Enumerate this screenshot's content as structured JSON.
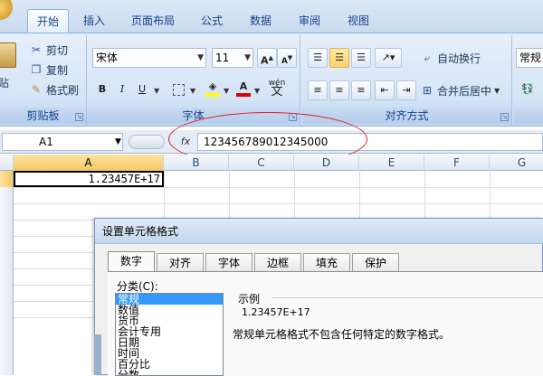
{
  "tabs": [
    "开始",
    "插入",
    "页面布局",
    "公式",
    "数据",
    "审阅",
    "视图"
  ],
  "clipboard": {
    "cut": "剪切",
    "copy": "复制",
    "format_painter": "格式刷",
    "paste_partial": "粘贴",
    "label": "剪贴板"
  },
  "font": {
    "name": "宋体",
    "size": "11",
    "bold": "B",
    "italic": "I",
    "underline": "U",
    "grow": "A",
    "shrink": "A",
    "color_a": "A",
    "wen": "wén",
    "label": "字体"
  },
  "alignment": {
    "wrap_text": "自动换行",
    "merge_center": "合并后居中",
    "label": "对齐方式"
  },
  "number": {
    "format_partial": "常规"
  },
  "formula_bar": {
    "name_box": "A1",
    "fx": "fx",
    "value": "123456789012345000"
  },
  "columns": [
    "A",
    "B",
    "C",
    "D",
    "E",
    "F",
    "G"
  ],
  "cell_a1": "1.23457E+17",
  "dialog": {
    "title": "设置单元格格式",
    "tabs": [
      "数字",
      "对齐",
      "字体",
      "边框",
      "填充",
      "保护"
    ],
    "category_label": "分类(C):",
    "categories": [
      "常规",
      "数值",
      "货币",
      "会计专用",
      "日期",
      "时间",
      "百分比",
      "分数"
    ],
    "sample_label": "示例",
    "sample_value": "1.23457E+17",
    "description": "常规单元格格式不包含任何特定的数字格式。"
  },
  "colors": {
    "accent": "#15428b",
    "highlight": "#e02020",
    "selection": "#3399ff"
  }
}
